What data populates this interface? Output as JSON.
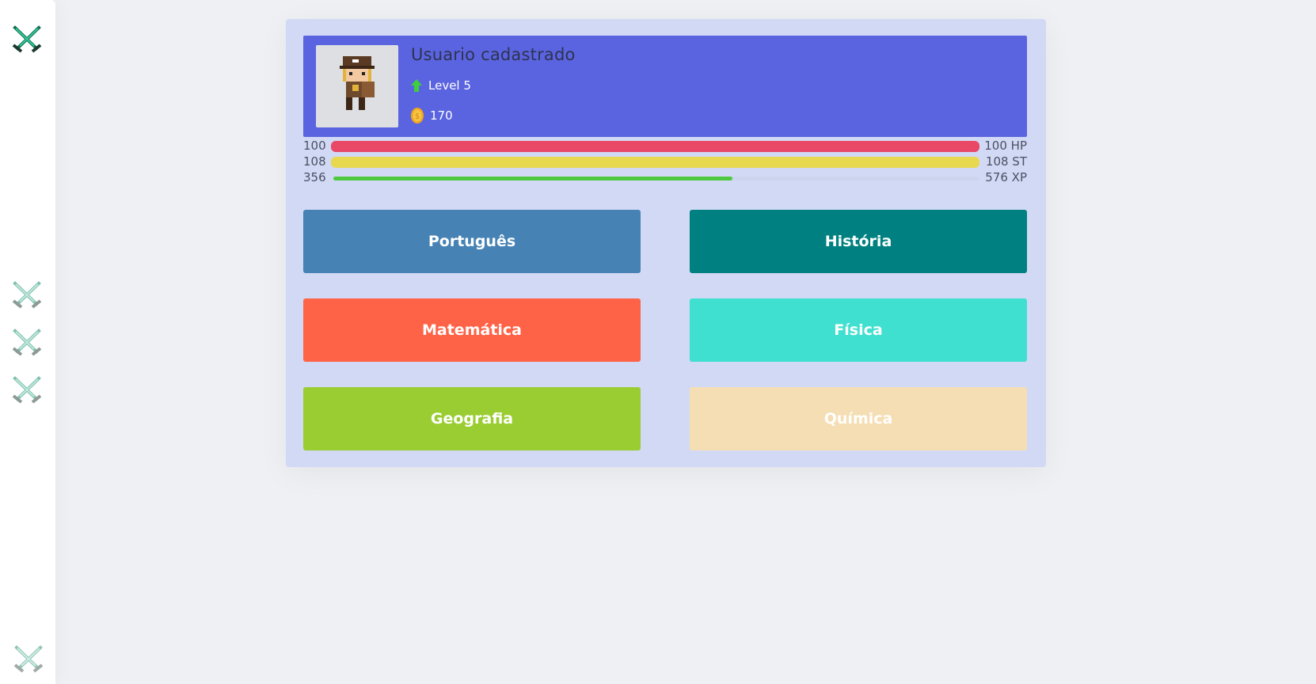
{
  "sidebar": {
    "top_icon": "crossed-swords-icon",
    "middle_icons": [
      "crossed-swords-icon",
      "crossed-swords-icon",
      "crossed-swords-icon"
    ],
    "bottom_icon": "crossed-swords-icon"
  },
  "profile": {
    "avatar": "pixel-character-avatar",
    "name": "Usuario cadastrado",
    "level_icon": "up-arrow-icon",
    "level": "Level 5",
    "coin_icon": "coin-icon",
    "coins": "170"
  },
  "stats": {
    "hp": {
      "current": "100",
      "max_label": "100 HP",
      "fraction": 1.0,
      "color": "#e94866"
    },
    "st": {
      "current": "108",
      "max_label": "108 ST",
      "fraction": 1.0,
      "color": "#e7d84f"
    },
    "xp": {
      "current": "356",
      "max_label": "576 XP",
      "fraction": 0.618,
      "color": "#4ec93f"
    }
  },
  "subjects": [
    {
      "label": "Português",
      "color": "#4682b4"
    },
    {
      "label": "História",
      "color": "#008080"
    },
    {
      "label": "Matemática",
      "color": "#ff6347"
    },
    {
      "label": "Física",
      "color": "#40e0d0"
    },
    {
      "label": "Geografia",
      "color": "#9acd32"
    },
    {
      "label": "Química",
      "color": "#f5deb3"
    }
  ]
}
